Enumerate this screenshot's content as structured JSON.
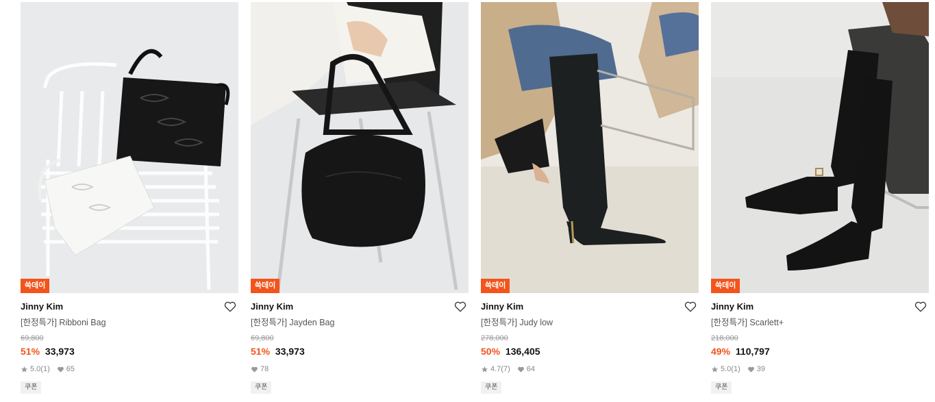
{
  "products": [
    {
      "badge": "쓱데이",
      "brand": "Jinny Kim",
      "title": "[한정특가] Ribboni Bag",
      "original_price": "69,800",
      "discount": "51%",
      "price": "33,973",
      "rating": "5.0",
      "review_count": "(1)",
      "likes": "65",
      "coupon": "쿠폰",
      "image_icon": "bag-on-chair"
    },
    {
      "badge": "쓱데이",
      "brand": "Jinny Kim",
      "title": "[한정특가] Jayden Bag",
      "original_price": "69,800",
      "discount": "51%",
      "price": "33,973",
      "likes": "78",
      "coupon": "쿠폰",
      "image_icon": "hobo-bag"
    },
    {
      "badge": "쓱데이",
      "brand": "Jinny Kim",
      "title": "[한정특가] Judy low",
      "original_price": "278,000",
      "discount": "50%",
      "price": "136,405",
      "rating": "4.7",
      "review_count": "(7)",
      "likes": "64",
      "coupon": "쿠폰",
      "image_icon": "heeled-boot"
    },
    {
      "badge": "쓱데이",
      "brand": "Jinny Kim",
      "title": "[한정특가] Scarlett+",
      "original_price": "218,000",
      "discount": "49%",
      "price": "110,797",
      "rating": "5.0",
      "review_count": "(1)",
      "likes": "39",
      "coupon": "쿠폰",
      "image_icon": "suede-boot"
    }
  ],
  "colors": {
    "accent": "#f2541b",
    "badge_text": "#ffffff",
    "muted": "#888888"
  }
}
